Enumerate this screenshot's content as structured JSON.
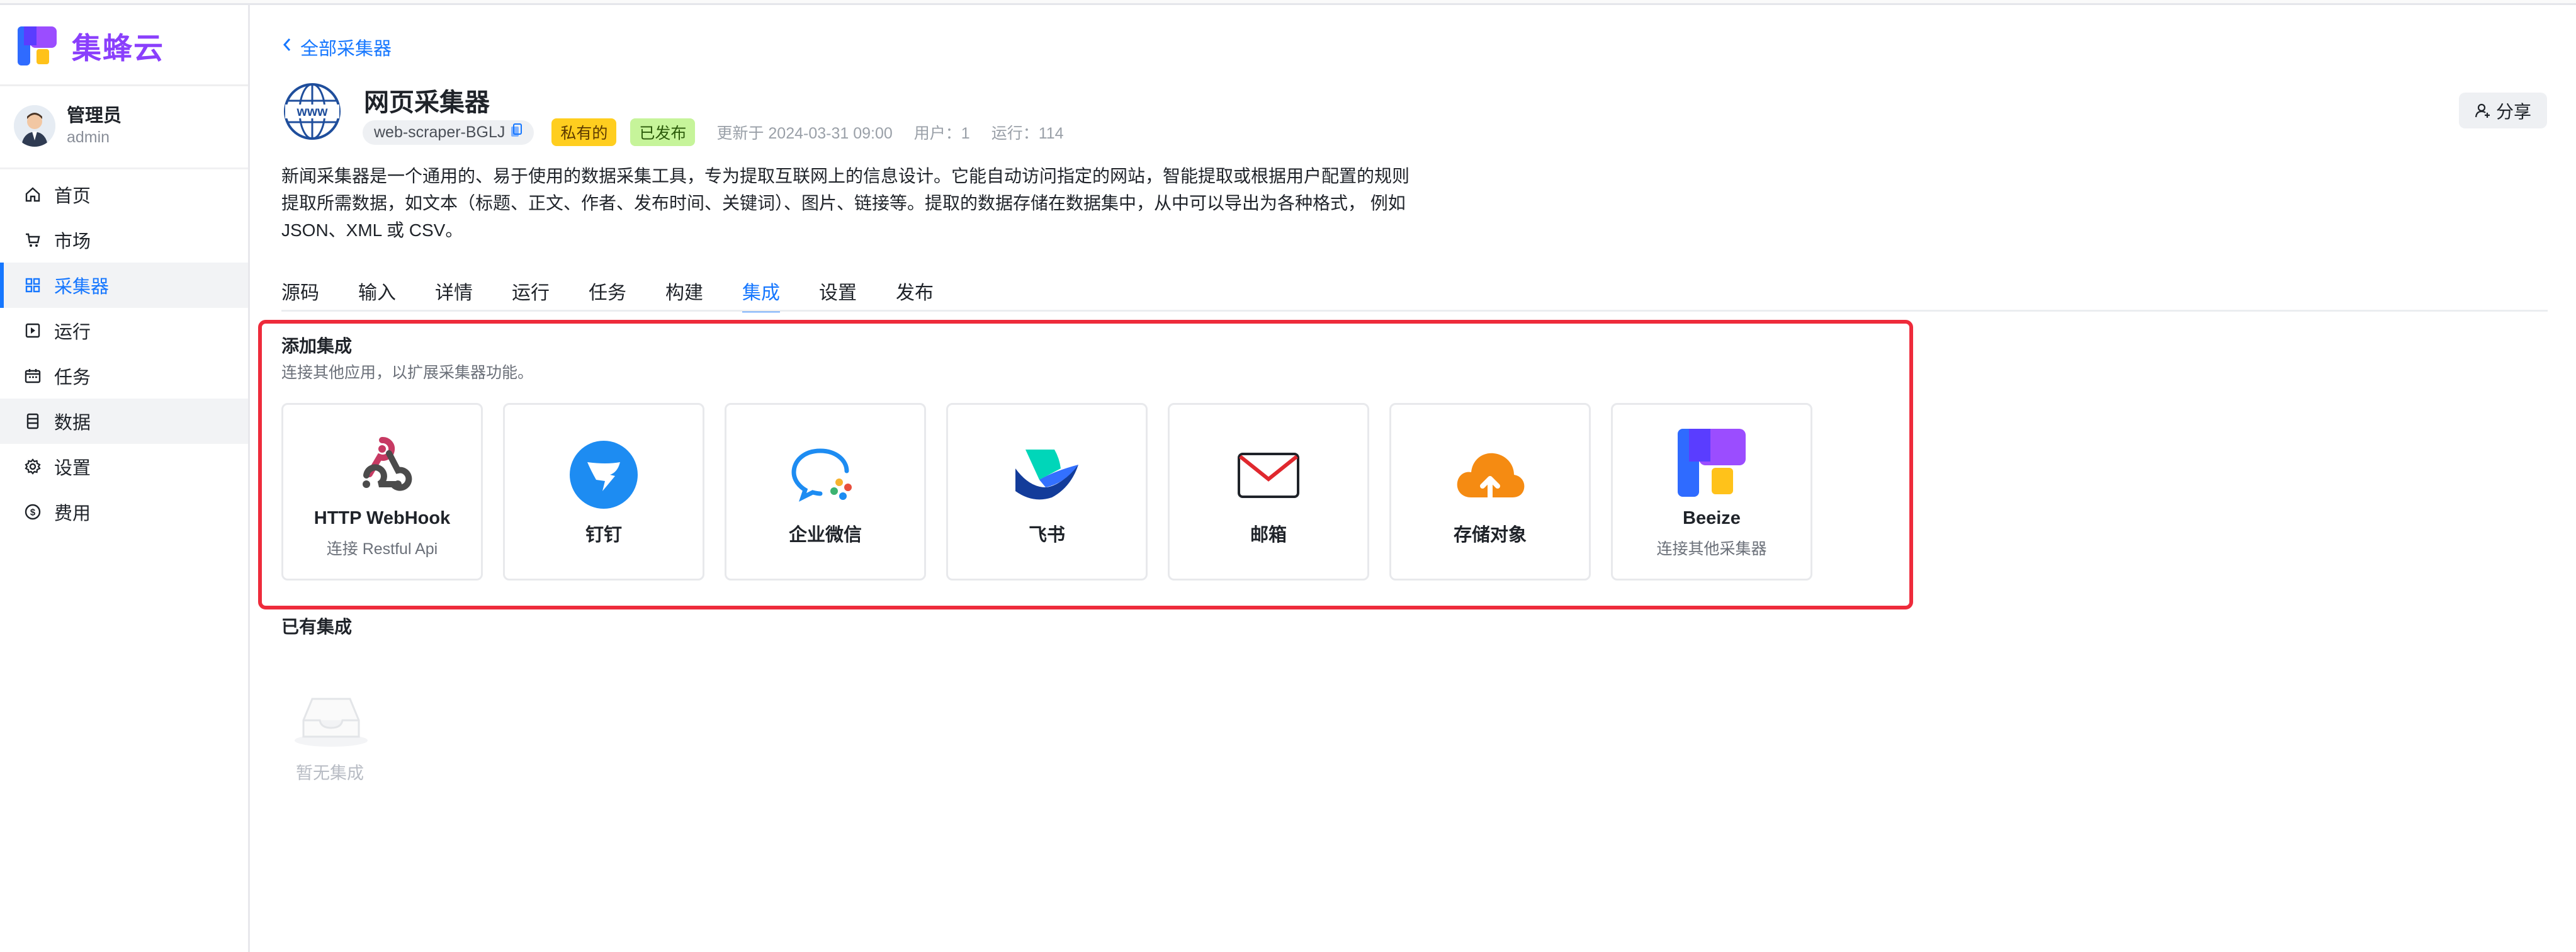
{
  "brand": {
    "name": "集蜂云"
  },
  "user": {
    "name": "管理员",
    "role": "admin"
  },
  "sidebar": {
    "items": [
      {
        "label": "首页",
        "icon": "home-icon"
      },
      {
        "label": "市场",
        "icon": "cart-icon"
      },
      {
        "label": "采集器",
        "icon": "grid-icon"
      },
      {
        "label": "运行",
        "icon": "play-box-icon"
      },
      {
        "label": "任务",
        "icon": "calendar-icon"
      },
      {
        "label": "数据",
        "icon": "database-icon"
      },
      {
        "label": "设置",
        "icon": "gear-icon"
      },
      {
        "label": "费用",
        "icon": "dollar-icon"
      }
    ]
  },
  "header": {
    "back_label": "全部采集器",
    "title": "网页采集器",
    "id_tag": "web-scraper-BGLJ",
    "private_tag": "私有的",
    "published_tag": "已发布",
    "updated": "更新于 2024-03-31 09:00",
    "users": "用户：1",
    "runs": "运行：114",
    "share_label": "分享",
    "description": "新闻采集器是一个通用的、易于使用的数据采集工具，专为提取互联网上的信息设计。它能自动访问指定的网站，智能提取或根据用户配置的规则提取所需数据，如文本（标题、正文、作者、发布时间、关键词）、图片、链接等。提取的数据存储在数据集中，从中可以导出为各种格式， 例如 JSON、XML 或 CSV。"
  },
  "tabs": [
    "源码",
    "输入",
    "详情",
    "运行",
    "任务",
    "构建",
    "集成",
    "设置",
    "发布"
  ],
  "integrations": {
    "title": "添加集成",
    "subtitle": "连接其他应用，以扩展采集器功能。",
    "cards": [
      {
        "name": "HTTP WebHook",
        "sub": "连接 Restful Api",
        "icon": "webhook-icon"
      },
      {
        "name": "钉钉",
        "sub": "",
        "icon": "dingtalk-icon"
      },
      {
        "name": "企业微信",
        "sub": "",
        "icon": "wecom-icon"
      },
      {
        "name": "飞书",
        "sub": "",
        "icon": "feishu-icon"
      },
      {
        "name": "邮箱",
        "sub": "",
        "icon": "mail-icon"
      },
      {
        "name": "存储对象",
        "sub": "",
        "icon": "cloud-upload-icon"
      },
      {
        "name": "Beeize",
        "sub": "连接其他采集器",
        "icon": "beeize-icon"
      }
    ],
    "existing_title": "已有集成",
    "empty_text": "暂无集成"
  },
  "colors": {
    "accent": "#1677ff",
    "brand": "#8a3ffc",
    "highlight": "#ee2b3b"
  }
}
